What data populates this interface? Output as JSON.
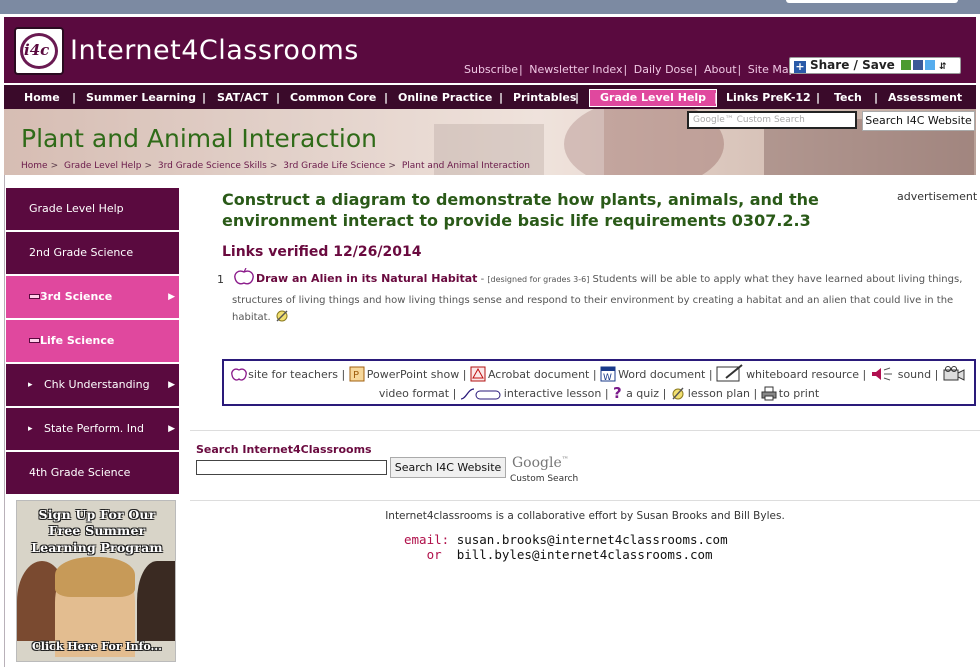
{
  "site": {
    "logo_text": "i4c",
    "title": "Internet4Classrooms",
    "top_links": [
      "Subscribe",
      "Newsletter Index",
      "Daily Dose",
      "About",
      "Site Map"
    ],
    "share_label": "Share / Save"
  },
  "nav": {
    "items": [
      "Home",
      "Summer Learning",
      "SAT/ACT",
      "Common Core",
      "Online Practice",
      "Printables",
      "Grade Level Help",
      "Links PreK-12",
      "Tech",
      "Assessment"
    ],
    "active": "Grade Level Help"
  },
  "banner": {
    "title": "Plant and Animal Interaction",
    "breadcrumbs": [
      "Home",
      "Grade Level Help",
      "3rd Grade Science Skills",
      "3rd Grade Life Science",
      "Plant and Animal Interaction"
    ],
    "search_placeholder": "Google™ Custom Search",
    "search_button": "Search I4C Website"
  },
  "sidebar": {
    "items": [
      {
        "label": "Grade Level Help"
      },
      {
        "label": "2nd Grade Science"
      },
      {
        "label": "3rd Science"
      },
      {
        "label": "Life Science"
      },
      {
        "label": "Chk Understanding"
      },
      {
        "label": "State Perform. Ind"
      },
      {
        "label": "4th Grade Science"
      }
    ],
    "promo": {
      "line1": "Sign Up For Our",
      "line2": "Free Summer",
      "line3": "Learning Program",
      "cta": "Click Here For Info..."
    }
  },
  "main": {
    "title": "Construct a diagram to demonstrate how plants, animals, and the environment interact to provide basic life requirements 0307.2.3",
    "advertisement": "advertisement",
    "verified": "Links verified 12/26/2014",
    "resources": [
      {
        "number": "1",
        "link": "Draw an Alien in its Natural Habitat",
        "dash": " - ",
        "note": "[designed for grades 3-6]",
        "description": " Students will be able to apply what they have learned about living things, structures of living things and how living things sense and respond to their environment by creating a habitat and an alien that could live in the habitat."
      }
    ],
    "legend": [
      {
        "icon": "apple-icon",
        "label": "site for teachers"
      },
      {
        "icon": "powerpoint-icon",
        "label": "PowerPoint show"
      },
      {
        "icon": "acrobat-icon",
        "label": "Acrobat document"
      },
      {
        "icon": "word-icon",
        "label": "Word document"
      },
      {
        "icon": "whiteboard-icon",
        "label": "whiteboard resource"
      },
      {
        "icon": "sound-icon",
        "label": "sound"
      },
      {
        "icon": "video-icon",
        "label": "video format"
      },
      {
        "icon": "interactive-icon",
        "label": "interactive lesson"
      },
      {
        "icon": "quiz-icon",
        "label": "a quiz"
      },
      {
        "icon": "lesson-plan-icon",
        "label": "lesson plan"
      },
      {
        "icon": "print-icon",
        "label": "to print"
      }
    ]
  },
  "search": {
    "label": "Search Internet4Classrooms",
    "button": "Search I4C Website",
    "google_logo": "Google",
    "google_sub": "Custom Search"
  },
  "footer": {
    "collab": "Internet4classrooms is a collaborative effort by Susan Brooks and Bill Byles.",
    "email_label": "email:",
    "email1": "susan.brooks@internet4classrooms.com",
    "or_label": "or",
    "email2": "bill.byles@internet4classrooms.com"
  },
  "colors": {
    "header_bg": "#5a0a3f",
    "nav_bg": "#3a0a2a",
    "active_pink": "#e0489e",
    "title_green": "#2a5a18",
    "link_maroon": "#6a0a3f"
  }
}
